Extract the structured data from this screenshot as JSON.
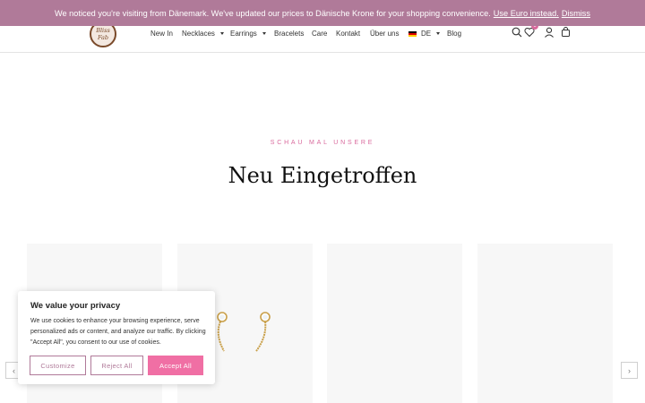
{
  "notice": {
    "message": "We noticed you're visiting from Dänemark. We've updated our prices to Dänische Krone for your shopping convenience.",
    "link_euro": "Use Euro instead.",
    "link_dismiss": "Dismiss"
  },
  "logo": {
    "line1": "Bliss",
    "line2": "Fab"
  },
  "nav": {
    "new_in": "New In",
    "necklaces": "Necklaces",
    "earrings": "Earrings",
    "bracelets": "Bracelets",
    "care": "Care",
    "kontakt": "Kontakt",
    "ueber_uns": "Über uns",
    "language": "DE",
    "blog": "Blog"
  },
  "wishlist_count": "0",
  "section": {
    "eyebrow": "SCHAU MAL UNSERE",
    "title": "Neu Eingetroffen"
  },
  "cookie": {
    "heading": "We value your privacy",
    "body": "We use cookies to enhance your browsing experience, serve personalized ads or content, and analyze our traffic. By clicking \"Accept All\", you consent to our use of cookies.",
    "customize": "Customize",
    "reject": "Reject All",
    "accept": "Accept All"
  },
  "colors": {
    "notice_bg": "#b07a99",
    "accent_pink": "#f06fa4",
    "eyebrow_pink": "#d96a9d"
  }
}
